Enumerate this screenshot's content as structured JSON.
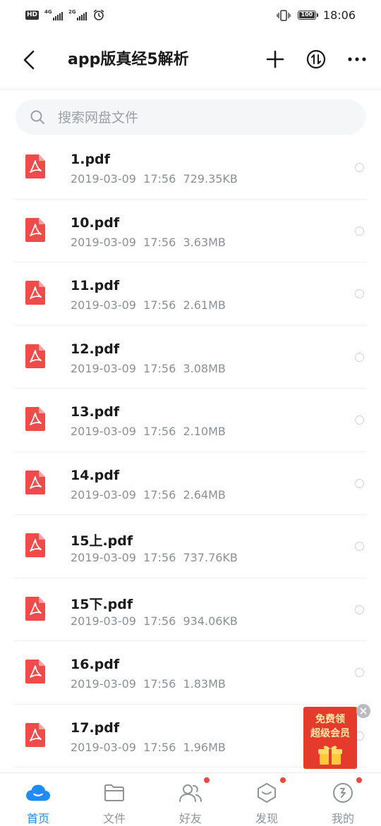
{
  "status_bar": {
    "hd": "HD",
    "network1": "4G",
    "network2": "2G",
    "battery": "100",
    "time": "18:06"
  },
  "header": {
    "title": "app版真经5解析",
    "icons": [
      "back-icon",
      "add-icon",
      "sort-icon",
      "more-icon"
    ]
  },
  "search": {
    "placeholder": "搜索网盘文件"
  },
  "files": [
    {
      "name": "1.pdf",
      "meta": "2019-03-09  17:56  729.35KB"
    },
    {
      "name": "10.pdf",
      "meta": "2019-03-09  17:56  3.63MB"
    },
    {
      "name": "11.pdf",
      "meta": "2019-03-09  17:56  2.61MB"
    },
    {
      "name": "12.pdf",
      "meta": "2019-03-09  17:56  3.08MB"
    },
    {
      "name": "13.pdf",
      "meta": "2019-03-09  17:56  2.10MB"
    },
    {
      "name": "14.pdf",
      "meta": "2019-03-09  17:56  2.64MB"
    },
    {
      "name": "15上.pdf",
      "meta": "2019-03-09  17:56  737.76KB"
    },
    {
      "name": "15下.pdf",
      "meta": "2019-03-09  17:56  934.06KB"
    },
    {
      "name": "16.pdf",
      "meta": "2019-03-09  17:56  1.83MB"
    },
    {
      "name": "17.pdf",
      "meta": "2019-03-09  17:56  1.96MB"
    }
  ],
  "promo": {
    "line1": "免费领",
    "line2": "超级会员"
  },
  "tabs": [
    {
      "label": "首页",
      "icon": "cloud-icon",
      "active": true
    },
    {
      "label": "文件",
      "icon": "folder-icon"
    },
    {
      "label": "好友",
      "icon": "friends-icon"
    },
    {
      "label": "发现",
      "icon": "discover-icon"
    },
    {
      "label": "我的",
      "icon": "profile-icon"
    }
  ],
  "colors": {
    "accent": "#1f8bff",
    "pdf_red": "#f04b4b",
    "badge_red": "#f2453d",
    "promo_red": "#e43b2c"
  }
}
